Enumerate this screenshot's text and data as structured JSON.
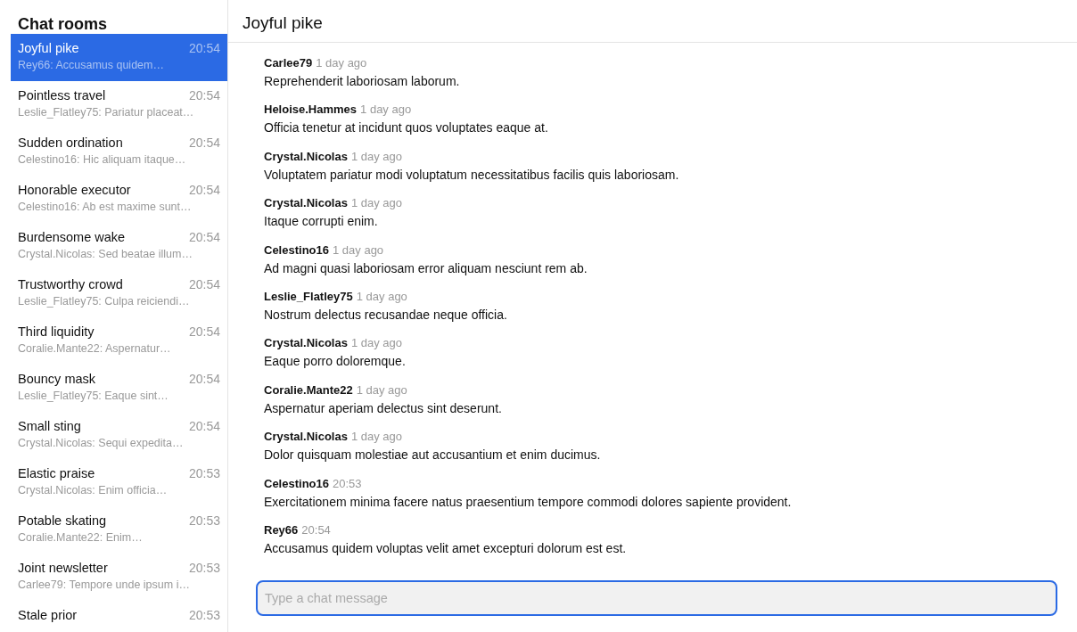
{
  "sidebar": {
    "title": "Chat rooms",
    "rooms": [
      {
        "name": "Joyful pike",
        "time": "20:54",
        "preview": "Rey66: Accusamus quidem…",
        "selected": true
      },
      {
        "name": "Pointless travel",
        "time": "20:54",
        "preview": "Leslie_Flatley75: Pariatur placeat…",
        "selected": false
      },
      {
        "name": "Sudden ordination",
        "time": "20:54",
        "preview": "Celestino16: Hic aliquam itaque…",
        "selected": false
      },
      {
        "name": "Honorable executor",
        "time": "20:54",
        "preview": "Celestino16: Ab est maxime sunt…",
        "selected": false
      },
      {
        "name": "Burdensome wake",
        "time": "20:54",
        "preview": "Crystal.Nicolas: Sed beatae illum…",
        "selected": false
      },
      {
        "name": "Trustworthy crowd",
        "time": "20:54",
        "preview": "Leslie_Flatley75: Culpa reiciendi…",
        "selected": false
      },
      {
        "name": "Third liquidity",
        "time": "20:54",
        "preview": "Coralie.Mante22: Aspernatur…",
        "selected": false
      },
      {
        "name": "Bouncy mask",
        "time": "20:54",
        "preview": "Leslie_Flatley75: Eaque sint…",
        "selected": false
      },
      {
        "name": "Small sting",
        "time": "20:54",
        "preview": "Crystal.Nicolas: Sequi expedita…",
        "selected": false
      },
      {
        "name": "Elastic praise",
        "time": "20:53",
        "preview": "Crystal.Nicolas: Enim officia…",
        "selected": false
      },
      {
        "name": "Potable skating",
        "time": "20:53",
        "preview": "Coralie.Mante22: Enim…",
        "selected": false
      },
      {
        "name": "Joint newsletter",
        "time": "20:53",
        "preview": "Carlee79: Tempore unde ipsum i…",
        "selected": false
      },
      {
        "name": "Stale prior",
        "time": "20:53",
        "selected": false
      }
    ]
  },
  "chat": {
    "title": "Joyful pike",
    "messages": [
      {
        "author": "Carlee79",
        "time": "1 day ago",
        "text": "Reprehenderit laboriosam laborum."
      },
      {
        "author": "Heloise.Hammes",
        "time": "1 day ago",
        "text": "Officia tenetur at incidunt quos voluptates eaque at."
      },
      {
        "author": "Crystal.Nicolas",
        "time": "1 day ago",
        "text": "Voluptatem pariatur modi voluptatum necessitatibus facilis quis laboriosam."
      },
      {
        "author": "Crystal.Nicolas",
        "time": "1 day ago",
        "text": "Itaque corrupti enim."
      },
      {
        "author": "Celestino16",
        "time": "1 day ago",
        "text": "Ad magni quasi laboriosam error aliquam nesciunt rem ab."
      },
      {
        "author": "Leslie_Flatley75",
        "time": "1 day ago",
        "text": "Nostrum delectus recusandae neque officia."
      },
      {
        "author": "Crystal.Nicolas",
        "time": "1 day ago",
        "text": "Eaque porro doloremque."
      },
      {
        "author": "Coralie.Mante22",
        "time": "1 day ago",
        "text": "Aspernatur aperiam delectus sint deserunt."
      },
      {
        "author": "Crystal.Nicolas",
        "time": "1 day ago",
        "text": "Dolor quisquam molestiae aut accusantium et enim ducimus."
      },
      {
        "author": "Celestino16",
        "time": "20:53",
        "text": "Exercitationem minima facere natus praesentium tempore commodi dolores sapiente provident."
      },
      {
        "author": "Rey66",
        "time": "20:54",
        "text": "Accusamus quidem voluptas velit amet excepturi dolorum est est."
      }
    ],
    "input": {
      "placeholder": "Type a chat message"
    }
  }
}
